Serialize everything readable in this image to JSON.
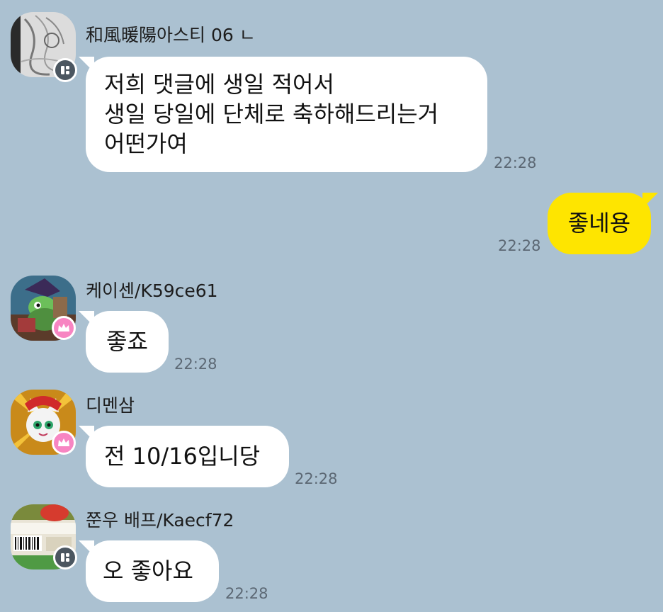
{
  "messages": [
    {
      "sender": "和風暖陽아스티 06 ㄴ",
      "badge": "moderator-badge",
      "lines": [
        "저희 댓글에 생일 적어서",
        "생일 당일에 단체로 축하해드리는거",
        "어떤가여"
      ],
      "time": "22:28"
    },
    {
      "mine": true,
      "lines": [
        "좋네용"
      ],
      "time": "22:28"
    },
    {
      "sender": "케이센/K59ce61",
      "badge": "host-crown-badge",
      "lines": [
        "좋죠"
      ],
      "time": "22:28"
    },
    {
      "sender": "디멘삼",
      "badge": "host-crown-badge",
      "lines": [
        "전 10/16입니당"
      ],
      "time": "22:28"
    },
    {
      "sender": "쭌우 배프/Kaecf72",
      "badge": "moderator-badge",
      "lines": [
        "오 좋아요"
      ],
      "time": "22:28"
    }
  ],
  "colors": {
    "background": "#abc1d1",
    "incoming_bubble": "#ffffff",
    "outgoing_bubble": "#fee500",
    "moderator_badge": "#4b5660",
    "host_badge": "#f785c2"
  }
}
